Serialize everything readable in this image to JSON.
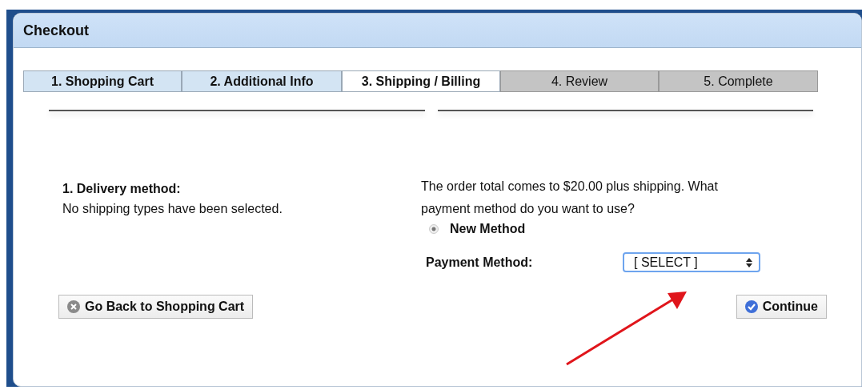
{
  "window": {
    "title": "Checkout"
  },
  "tabs": [
    {
      "label": "1. Shopping Cart",
      "kind": "done",
      "selected": false
    },
    {
      "label": "2. Additional Info",
      "kind": "done",
      "selected": false
    },
    {
      "label": "3. Shipping / Billing",
      "kind": "done",
      "selected": true
    },
    {
      "label": "4. Review",
      "kind": "pending",
      "selected": false
    },
    {
      "label": "5. Complete",
      "kind": "pending",
      "selected": false
    }
  ],
  "delivery": {
    "heading": "1. Delivery method:",
    "message": "No shipping types have been selected."
  },
  "payment": {
    "prompt": "The order total comes to $20.00 plus shipping. What payment method do you want to use?",
    "options": [
      {
        "label": "New Method",
        "selected": true
      }
    ],
    "field_label": "Payment Method:",
    "select_value": "[ SELECT ]"
  },
  "buttons": {
    "back": "Go Back to Shopping Cart",
    "continue": "Continue"
  }
}
